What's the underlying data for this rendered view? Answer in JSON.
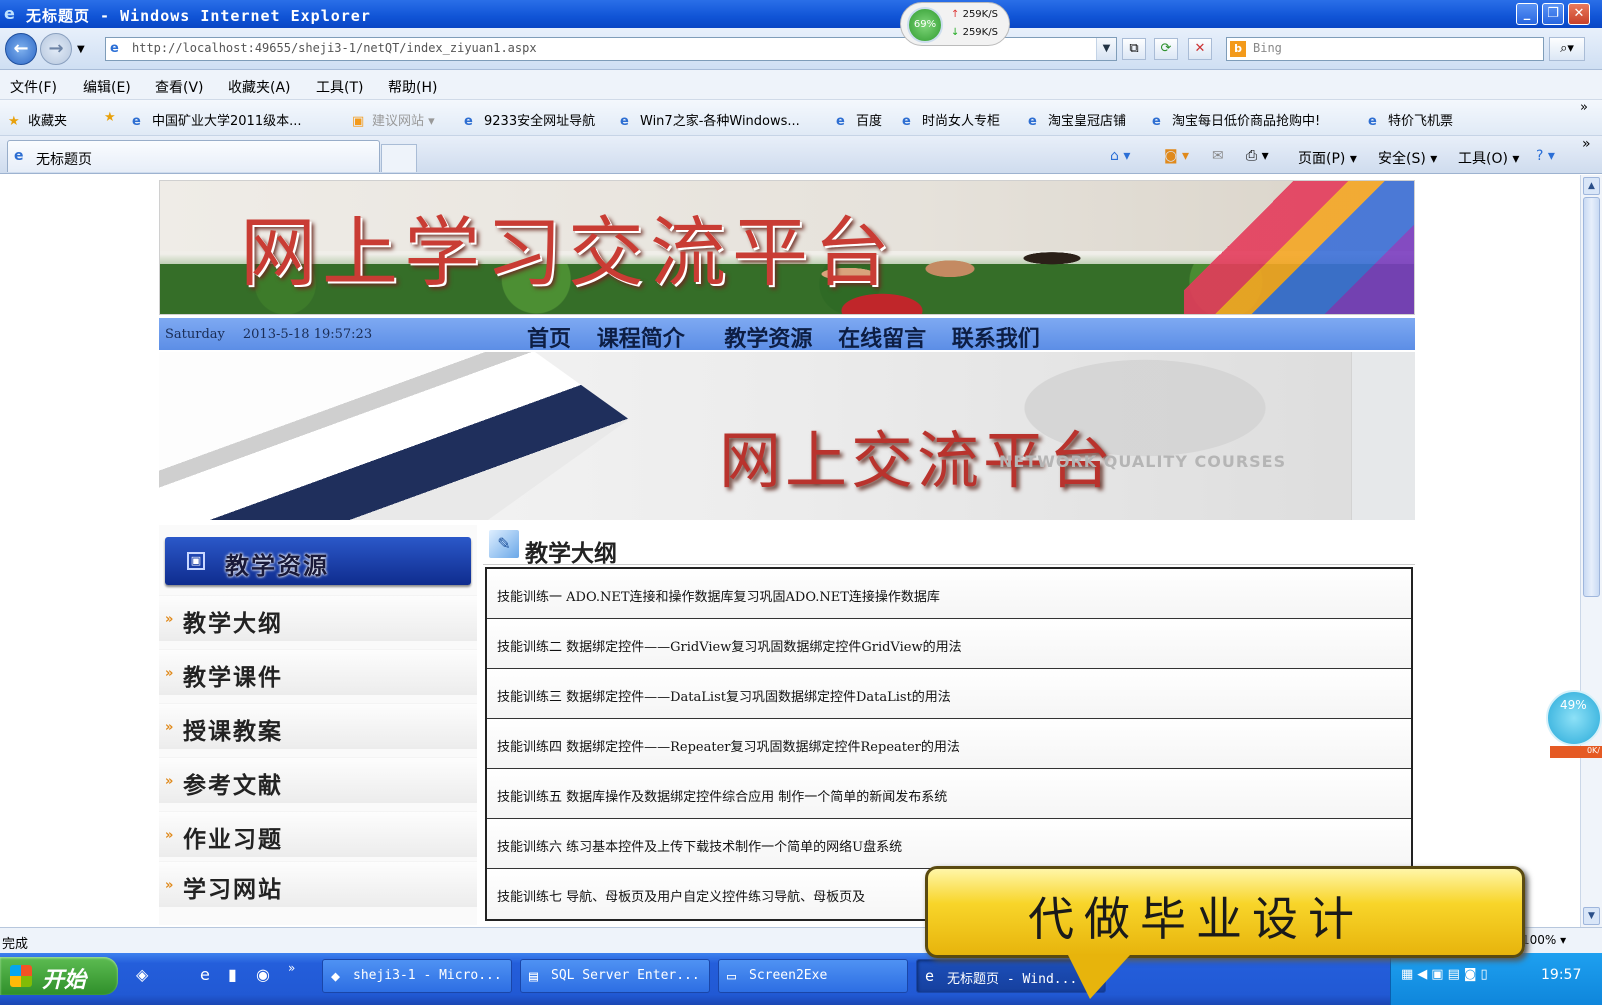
{
  "window": {
    "title": "无标题页 - Windows Internet Explorer",
    "controls": [
      "_",
      "❐",
      "✕"
    ]
  },
  "netmon": {
    "percent": "69%",
    "up": "259K/S",
    "down": "259K/S"
  },
  "address": {
    "url": "http://localhost:49655/sheji3-1/netQT/index_ziyuan1.aspx",
    "search_placeholder": "Bing"
  },
  "menu": [
    "文件(F)",
    "编辑(E)",
    "查看(V)",
    "收藏夹(A)",
    "工具(T)",
    "帮助(H)"
  ],
  "favorites": {
    "label": "收藏夹",
    "items": [
      "中国矿业大学2011级本...",
      "建议网站",
      "9233安全网址导航",
      "Win7之家-各种Windows...",
      "百度",
      "时尚女人专柜",
      "淘宝皇冠店铺",
      "淘宝每日低价商品抢购中!",
      "特价飞机票"
    ]
  },
  "tabs": [
    {
      "label": "无标题页"
    }
  ],
  "commandbar": {
    "page": "页面(P)",
    "safety": "安全(S)",
    "tools": "工具(O)"
  },
  "site": {
    "banner_title": "网上学习交流平台",
    "weekday": "Saturday",
    "datetime": "2013-5-18 19:57:23",
    "nav": [
      "首页",
      "课程简介",
      "教学资源",
      "在线留言",
      "联系我们"
    ],
    "banner2_title": "网上交流平台",
    "banner2_sub": "NETWORK QUALITY COURSES",
    "sidebar": {
      "title": "教学资源",
      "items": [
        "教学大纲",
        "教学课件",
        "授课教案",
        "参考文献",
        "作业习题",
        "学习网站"
      ]
    },
    "main": {
      "title": "教学大纲",
      "rows": [
        "技能训练一 ADO.NET连接和操作数据库复习巩固ADO.NET连接操作数据库",
        "技能训练二 数据绑定控件——GridView复习巩固数据绑定控件GridView的用法",
        "技能训练三 数据绑定控件——DataList复习巩固数据绑定控件DataList的用法",
        "技能训练四 数据绑定控件——Repeater复习巩固数据绑定控件Repeater的用法",
        "技能训练五 数据库操作及数据绑定控件综合应用 制作一个简单的新闻发布系统",
        "技能训练六 练习基本控件及上传下载技术制作一个简单的网络U盘系统",
        "技能训练七 导航、母板页及用户自定义控件练习导航、母板页及"
      ]
    }
  },
  "ad": {
    "text": "代做毕业设计"
  },
  "widget": {
    "percent": "49%",
    "speed": "0K/"
  },
  "status": {
    "text": "完成",
    "zoom": "100%"
  },
  "taskbar": {
    "start": "开始",
    "tasks": [
      "sheji3-1 - Micro...",
      "SQL Server Enter...",
      "Screen2Exe",
      "无标题页 - Wind..."
    ],
    "clock": "19:57"
  }
}
